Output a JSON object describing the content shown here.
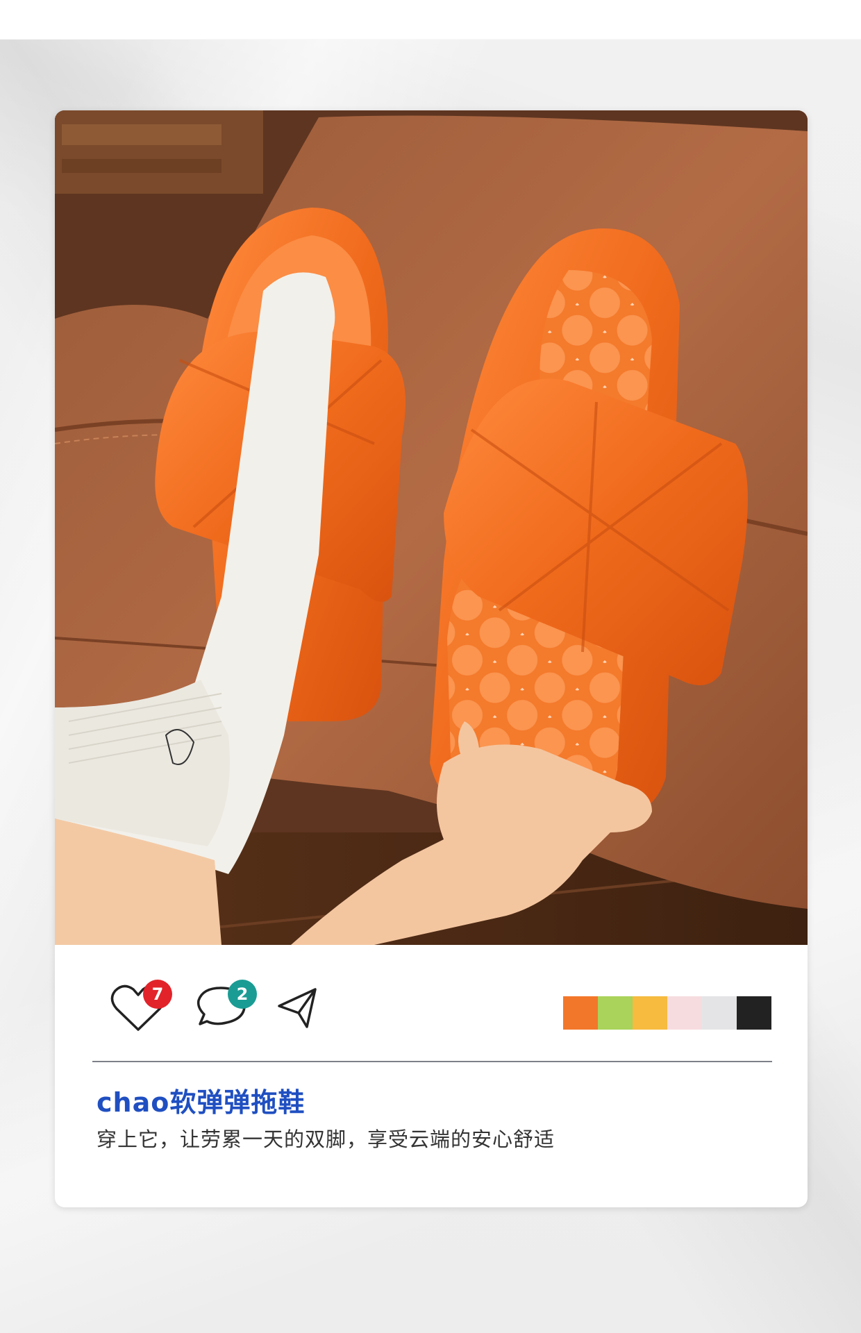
{
  "post": {
    "title": "chao软弹弹拖鞋",
    "subtitle": "穿上它，让劳累一天的双脚，享受云端的安心舒适"
  },
  "actions": {
    "like_count": "7",
    "comment_count": "2",
    "like_icon": "heart-icon",
    "comment_icon": "speech-bubble-icon",
    "share_icon": "paper-plane-icon"
  },
  "colors": {
    "title": "#1f4fc1",
    "like_badge": "#e2232a",
    "comment_badge": "#1a9c94",
    "product_orange": "#f06a1c"
  },
  "color_options": [
    "#f2772a",
    "#a9d35a",
    "#f6bb3f",
    "#f6dcdf",
    "#e4e4e6",
    "#222222"
  ]
}
